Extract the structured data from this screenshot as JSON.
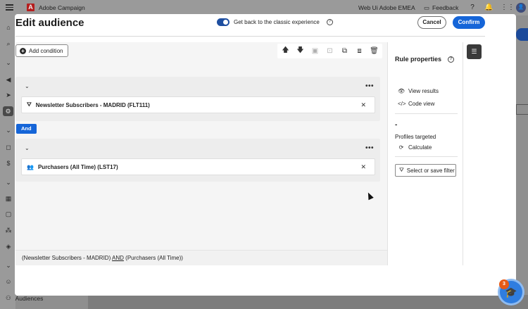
{
  "topbar": {
    "app_name": "Adobe Campaign",
    "logo_text": "A",
    "org_name": "Web Ui Adobe EMEA",
    "feedback_label": "Feedback",
    "avatar_text": "👤"
  },
  "sidenav": {
    "bottom_item_label": "Audiences"
  },
  "modal": {
    "title": "Edit audience",
    "classic_toggle_label": "Get back to the classic experience",
    "cancel_label": "Cancel",
    "confirm_label": "Confirm",
    "add_condition_label": "Add condition",
    "and_label": "And",
    "conditions": [
      {
        "label": "Newsletter Subscribers - MADRID (FLT111)",
        "icon": "filter-icon"
      },
      {
        "label": "Purchasers (All Time) (LST17)",
        "icon": "audience-icon"
      }
    ],
    "summary": {
      "part1": "(Newsletter Subscribers - MADRID)",
      "operator": "AND",
      "part2": "(Purchasers (All Time))"
    }
  },
  "rule_properties": {
    "title": "Rule properties",
    "view_results": "View results",
    "code_view": "Code view",
    "profiles_count": "-",
    "profiles_targeted": "Profiles targeted",
    "calculate": "Calculate",
    "select_or_save_filter": "Select or save filter"
  },
  "help_fab": {
    "badge": "3"
  },
  "colors": {
    "accent": "#1565d8",
    "toggle": "#1f4fa0",
    "notification": "#e65a16"
  }
}
